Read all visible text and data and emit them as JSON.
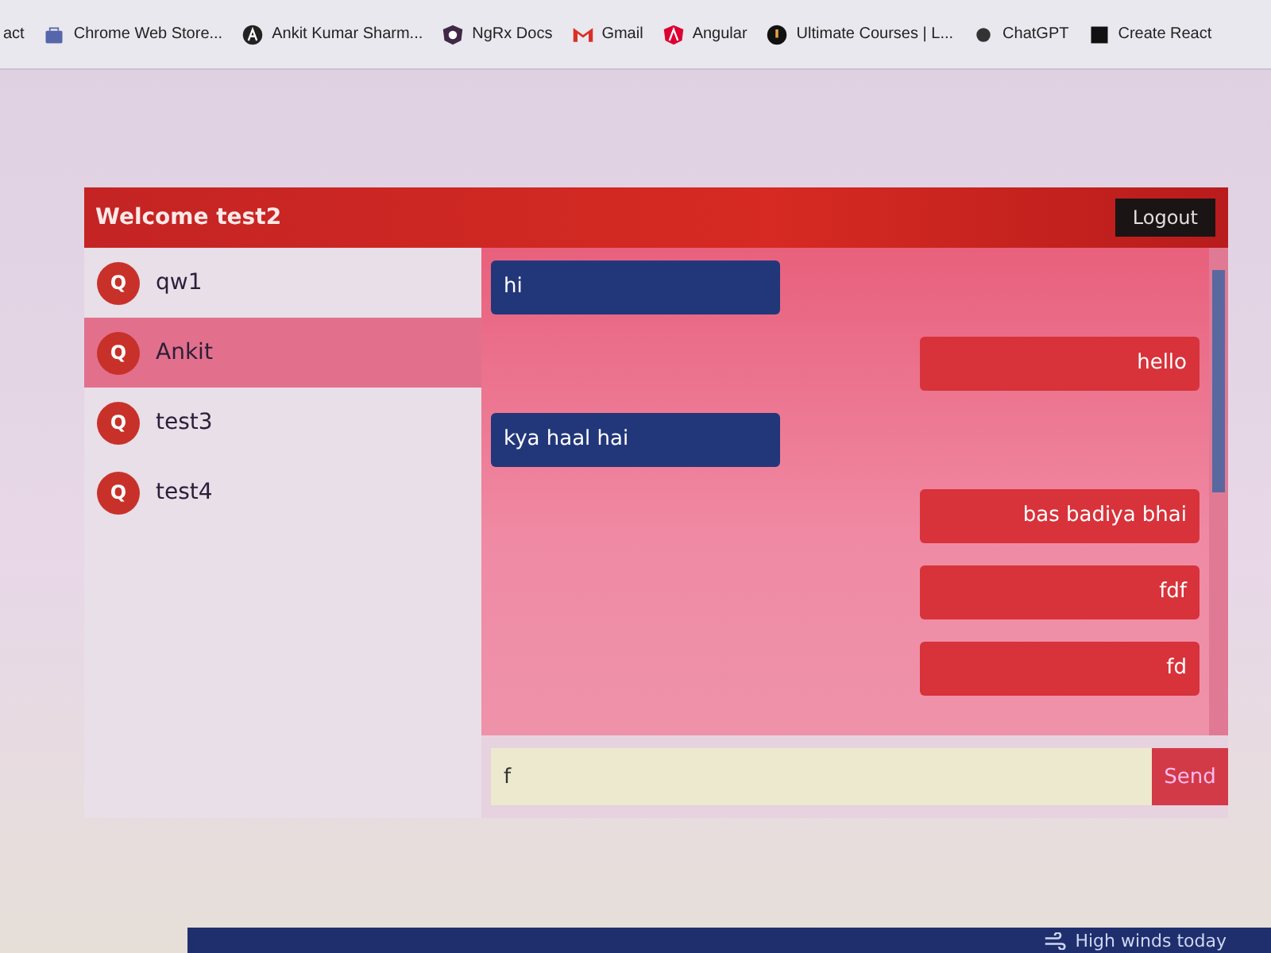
{
  "bookmarks_bar": {
    "items": [
      {
        "label": "act"
      },
      {
        "label": "Chrome Web Store..."
      },
      {
        "label": "Ankit Kumar Sharm..."
      },
      {
        "label": "NgRx Docs"
      },
      {
        "label": "Gmail"
      },
      {
        "label": "Angular"
      },
      {
        "label": "Ultimate Courses | L..."
      },
      {
        "label": "ChatGPT"
      },
      {
        "label": "Create React"
      }
    ]
  },
  "chat_app": {
    "header": {
      "title": "Welcome test2",
      "logout_button": "Logout"
    },
    "contacts": [
      {
        "avatar": "Q",
        "name": "qw1",
        "selected": false
      },
      {
        "avatar": "Q",
        "name": "Ankit",
        "selected": true
      },
      {
        "avatar": "Q",
        "name": "test3",
        "selected": false
      },
      {
        "avatar": "Q",
        "name": "test4",
        "selected": false
      }
    ],
    "messages": [
      {
        "kind": "received",
        "text": "hi"
      },
      {
        "kind": "sent",
        "text": "hello"
      },
      {
        "kind": "received",
        "text": "kya haal hai"
      },
      {
        "kind": "sent",
        "text": "bas badiya bhai"
      },
      {
        "kind": "sent",
        "text": "fdf"
      },
      {
        "kind": "sent",
        "text": "fd"
      }
    ],
    "composer": {
      "value": "f",
      "send_button": "Send"
    }
  },
  "taskbar": {
    "weather": "High winds today"
  }
}
